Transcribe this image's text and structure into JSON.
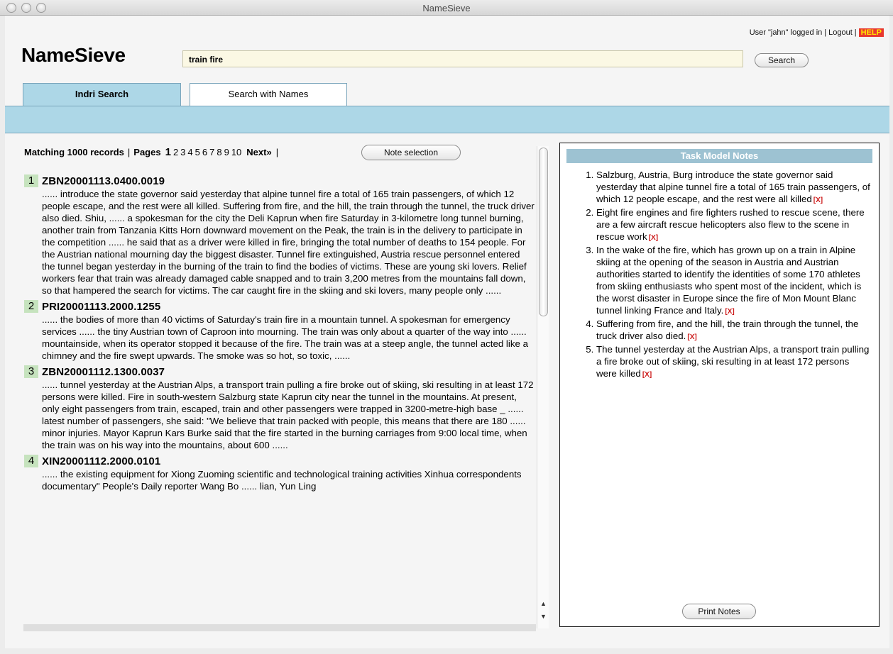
{
  "window": {
    "title": "NameSieve"
  },
  "header": {
    "logo": "NameSieve",
    "user_status": "User \"jahn\" logged in",
    "separator": "|",
    "logout": "Logout",
    "help": "HELP",
    "search_value": "train fire",
    "search_button": "Search"
  },
  "tabs": [
    {
      "label": "Indri Search",
      "active": true
    },
    {
      "label": "Search with Names",
      "active": false
    }
  ],
  "results": {
    "matching": "Matching 1000 records",
    "pages_label": "Pages",
    "current_page": "1",
    "pages": [
      "2",
      "3",
      "4",
      "5",
      "6",
      "7",
      "8",
      "9",
      "10"
    ],
    "next": "Next»",
    "note_selection": "Note selection",
    "records": [
      {
        "num": "1",
        "id": "ZBN20001113.0400.0019",
        "snippet": "...... introduce the state governor said yesterday that alpine tunnel fire a total of 165 train passengers, of which 12 people escape, and the rest were all killed. Suffering from fire, and the hill, the train through the tunnel, the truck driver also died. Shiu, ...... a spokesman for the city the Deli Kaprun when fire Saturday in 3-kilometre long tunnel burning, another train from Tanzania Kitts Horn downward movement on the Peak, the train is in the delivery to participate in the competition ...... he said that as a driver were killed in fire, bringing the total number of deaths to 154 people. For the Austrian national mourning day the biggest disaster. Tunnel fire extinguished, Austria rescue personnel entered the tunnel began yesterday in the burning of the train to find the bodies of victims. These are young ski lovers. Relief workers fear that train was already damaged cable snapped and to train 3,200 metres from the mountains fall down, so that hampered the search for victims. The car caught fire in the skiing and ski lovers, many people only ......"
      },
      {
        "num": "2",
        "id": "PRI20001113.2000.1255",
        "snippet": "...... the bodies of more than 40 victims of Saturday's train fire in a mountain tunnel. A spokesman for emergency services ...... the tiny Austrian town of Caproon into mourning. The train was only about a quarter of the way into ...... mountainside, when its operator stopped it because of the fire. The train was at a steep angle, the tunnel acted like a chimney and the fire swept upwards. The smoke was so hot, so toxic, ......"
      },
      {
        "num": "3",
        "id": "ZBN20001112.1300.0037",
        "snippet": "...... tunnel yesterday at the Austrian Alps, a transport train pulling a fire broke out of skiing, ski resulting in at least 172 persons were killed. Fire in south-western Salzburg state Kaprun city near the tunnel in the mountains. At present, only eight passengers from train, escaped, train and other passengers were trapped in 3200-metre-high base _ ...... latest number of passengers, she said: \"We believe that train packed with people, this means that there are 180 ...... minor injuries. Mayor Kaprun Kars Burke said that the fire started in the burning carriages from 9:00 local time, when the train was on his way into the mountains, about 600 ......"
      },
      {
        "num": "4",
        "id": "XIN20001112.2000.0101",
        "snippet": "...... the existing equipment for Xiong Zuoming scientific and technological training activities Xinhua correspondents documentary\" People's Daily reporter Wang Bo ...... lian, Yun Ling"
      }
    ]
  },
  "notes": {
    "title": "Task Model Notes",
    "remove_label": "[X]",
    "items": [
      "Salzburg, Austria, Burg introduce the state governor said yesterday that alpine tunnel fire a total of 165 train passengers, of which 12 people escape, and the rest were all killed",
      "Eight fire engines and fire fighters rushed to rescue scene, there are a few aircraft rescue helicopters also flew to the scene in rescue work",
      "In the wake of the fire, which has grown up on a train in Alpine skiing at the opening of the season in Austria and Austrian authorities started to identify the identities of some 170 athletes from skiing enthusiasts who spent most of the incident, which is the worst disaster in Europe since the fire of Mon Mount Blanc tunnel linking France and Italy.",
      "Suffering from fire, and the hill, the train through the tunnel, the truck driver also died.",
      "The tunnel yesterday at the Austrian Alps, a transport train pulling a fire broke out of skiing, ski resulting in at least 172 persons were killed"
    ],
    "print_button": "Print Notes"
  },
  "colors": {
    "tab_active": "#add7e7",
    "search_bg": "#fbf8e4",
    "record_num_bg": "#c6e3be",
    "help_bg": "#e8392f",
    "notes_header": "#9dc2d2"
  }
}
